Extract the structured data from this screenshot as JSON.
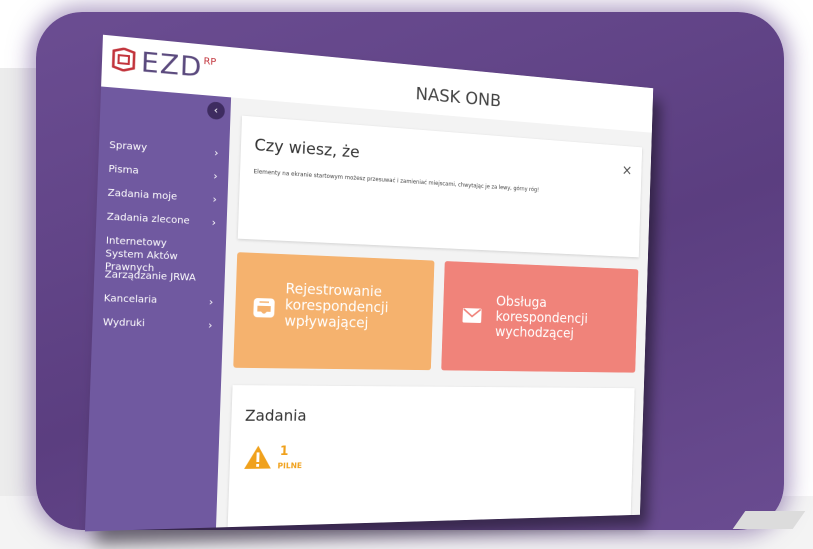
{
  "header": {
    "logo_text": "EZD",
    "logo_sup": "RP",
    "org_name": "NASK ONB"
  },
  "sidebar": {
    "collapse_icon": "chevron-left-icon",
    "items": [
      {
        "label": "Sprawy",
        "has_chevron": true
      },
      {
        "label": "Pisma",
        "has_chevron": true
      },
      {
        "label": "Zadania moje",
        "has_chevron": true
      },
      {
        "label": "Zadania zlecone",
        "has_chevron": true
      },
      {
        "label": "Internetowy System Aktów Prawnych",
        "has_chevron": false
      },
      {
        "label": "Zarządzanie JRWA",
        "has_chevron": false
      },
      {
        "label": "Kancelaria",
        "has_chevron": true
      },
      {
        "label": "Wydruki",
        "has_chevron": true
      }
    ],
    "chevron_glyph": "›"
  },
  "info_card": {
    "title": "Czy wiesz, że",
    "close_glyph": "×",
    "text": "Elementy na ekranie startowym możesz przesuwać i zamieniać miejscami, chwytając je za lewy, górny róg!"
  },
  "tiles": {
    "incoming": {
      "label": "Rejestrowanie korespondencji wpływającej",
      "icon": "inbox-icon",
      "color": "#f5b26e"
    },
    "outgoing": {
      "label": "Obsługa korespondencji wychodzącej",
      "icon": "envelope-icon",
      "color": "#f0837a"
    }
  },
  "tasks": {
    "title": "Zadania",
    "count": "1",
    "urgent_label": "PILNE",
    "icon": "warning-icon",
    "color": "#f0a11c"
  },
  "colors": {
    "sidebar": "#7059a0",
    "frame": "#5b3e80"
  }
}
